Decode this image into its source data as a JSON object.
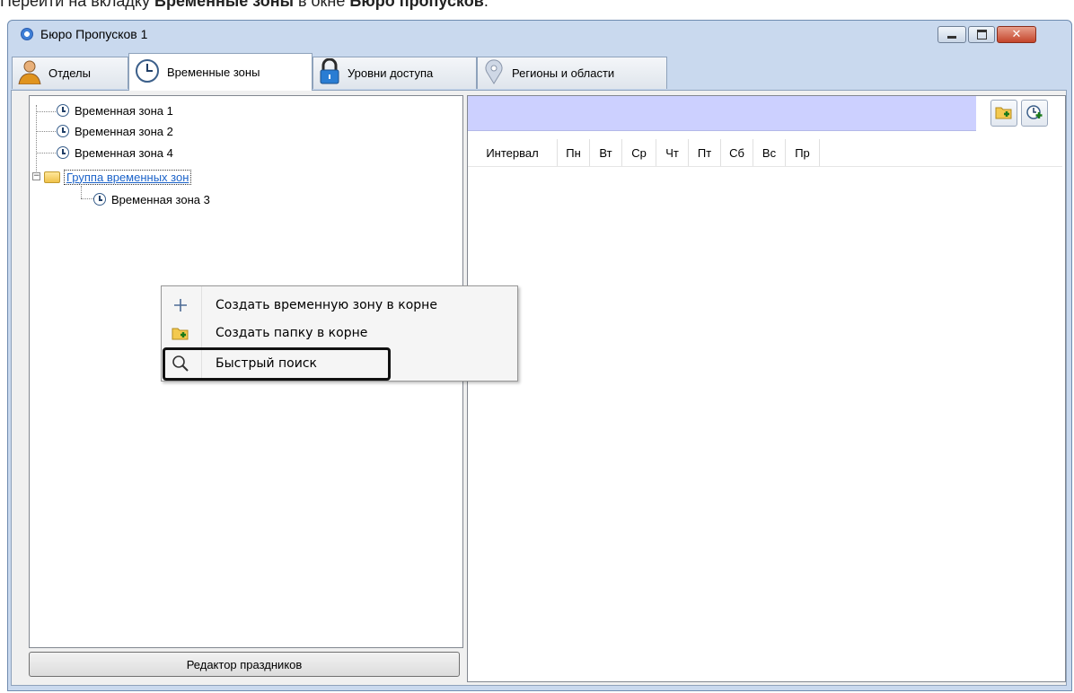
{
  "instruction": {
    "prefix": "Перейти на вкладку ",
    "tab_name": "Временные зоны",
    "mid": " в окне ",
    "window_name": "Бюро пропусков",
    "suffix": "."
  },
  "window": {
    "title": "Бюро Пропусков 1"
  },
  "tabs": [
    {
      "label": "Отделы",
      "icon": "person-icon"
    },
    {
      "label": "Временные зоны",
      "icon": "clock-icon",
      "active": true
    },
    {
      "label": "Уровни доступа",
      "icon": "lock-icon"
    },
    {
      "label": "Регионы и области",
      "icon": "map-pin-icon"
    }
  ],
  "tree": {
    "items": [
      {
        "label": "Временная зона 1"
      },
      {
        "label": "Временная зона 2"
      },
      {
        "label": "Временная зона 4"
      },
      {
        "label": "Группа временных зон",
        "selected": true
      },
      {
        "label": "Временная зона 3"
      }
    ]
  },
  "grid": {
    "columns": [
      "Интервал",
      "Пн",
      "Вт",
      "Ср",
      "Чт",
      "Пт",
      "Сб",
      "Вс",
      "Пр"
    ]
  },
  "footer": {
    "holiday_editor_label": "Редактор праздников"
  },
  "context_menu": {
    "items": [
      {
        "label": "Создать временную зону в корне",
        "icon": "plus-icon"
      },
      {
        "label": "Создать папку в корне",
        "icon": "new-folder-icon"
      },
      {
        "label": "Быстрый поиск",
        "icon": "search-icon",
        "highlighted": true
      }
    ]
  },
  "colors": {
    "toolbar_bg": "#ccd0ff",
    "window_frame": "#c9d9ee",
    "selected_text": "#1c63c9"
  }
}
